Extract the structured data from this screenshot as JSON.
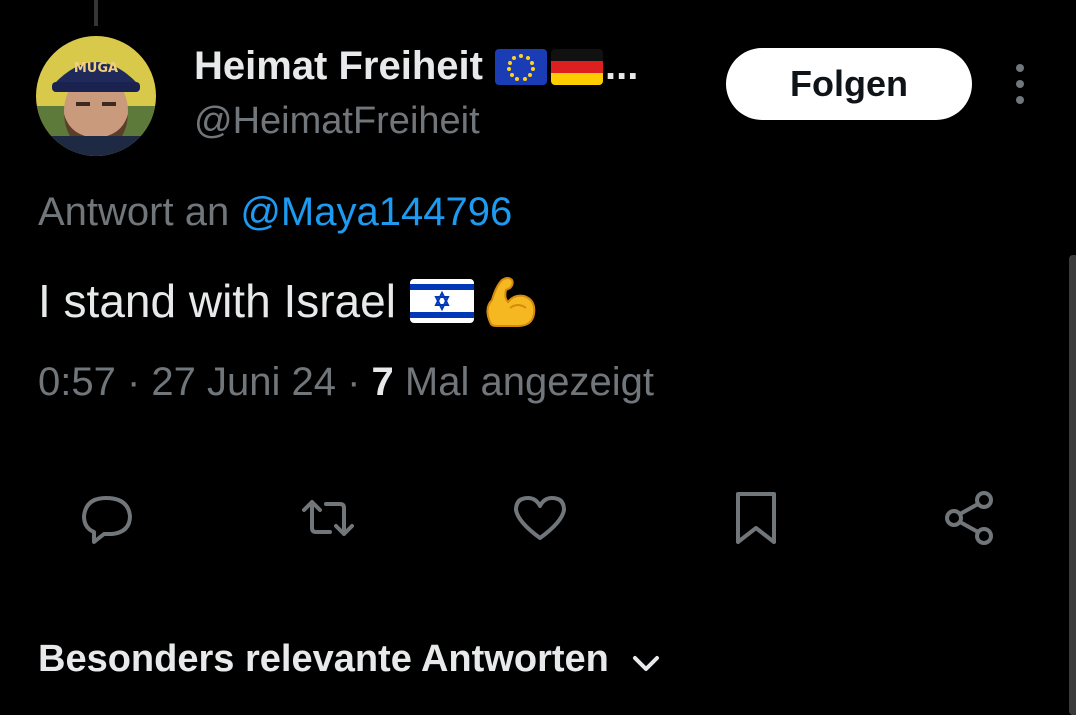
{
  "author": {
    "display_name": "Heimat Freiheit",
    "ellipsis": "...",
    "handle": "@HeimatFreiheit",
    "avatar_cap_text": "MUGA",
    "flags": [
      "flag-eu-icon",
      "flag-de-icon"
    ]
  },
  "follow_label": "Folgen",
  "reply": {
    "prefix": "Antwort an ",
    "mention": "@Maya144796"
  },
  "tweet": {
    "text": "I stand with Israel",
    "emojis": [
      "flag-israel-icon",
      "flexed-biceps-icon"
    ]
  },
  "meta": {
    "time": "0:57",
    "sep1": " · ",
    "date": "27 Juni 24",
    "sep2": " · ",
    "views_count": "7",
    "views_label": " Mal angezeigt"
  },
  "actions": [
    "reply-icon",
    "retweet-icon",
    "like-icon",
    "bookmark-icon",
    "share-icon"
  ],
  "replies_sort_label": "Besonders relevante Antworten",
  "colors": {
    "background": "#000000",
    "text": "#e7e9ea",
    "secondary": "#71767b",
    "link": "#1d9bf0",
    "button_bg": "#ffffff"
  }
}
